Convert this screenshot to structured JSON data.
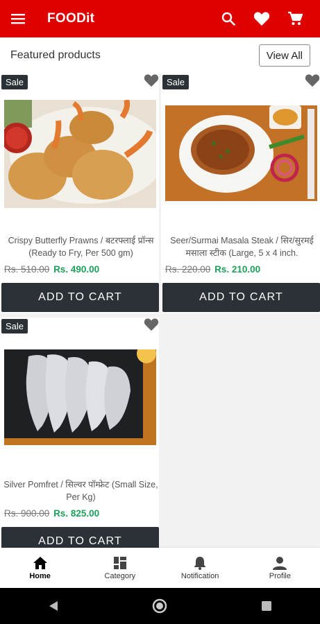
{
  "app": {
    "brand": "FOODit",
    "accent": "#df0000"
  },
  "appbar": {
    "icons": [
      "menu-icon",
      "search-icon",
      "heart-icon",
      "cart-icon"
    ]
  },
  "section": {
    "title": "Featured products",
    "view_all": "View All"
  },
  "products": [
    {
      "badge": "Sale",
      "name": "Crispy Butterfly Prawns / बटरफ्लाई प्रॉन्स (Ready to Fry, Per 500 gm)",
      "old_price": "Rs. 510.00",
      "new_price": "Rs. 490.00",
      "cta": "ADD TO CART"
    },
    {
      "badge": "Sale",
      "name": "Seer/Surmai Masala Steak / सिर/सुरमई मसाला स्टीक (Large, 5 x 4 inch.",
      "old_price": "Rs. 220.00",
      "new_price": "Rs. 210.00",
      "cta": "ADD TO CART"
    },
    {
      "badge": "Sale",
      "name": "Silver Pomfret / सिल्वर पॉम्फ्रेट (Small Size, Per Kg)",
      "old_price": "Rs. 900.00",
      "new_price": "Rs. 825.00",
      "cta": "ADD TO CART"
    }
  ],
  "bottom_nav": [
    {
      "label": "Home",
      "icon": "home-icon",
      "active": true
    },
    {
      "label": "Category",
      "icon": "category-icon"
    },
    {
      "label": "Notification",
      "icon": "bell-icon"
    },
    {
      "label": "Profile",
      "icon": "person-icon"
    }
  ],
  "colors": {
    "price_new": "#1ea05a",
    "button_dark": "#2b3137"
  }
}
